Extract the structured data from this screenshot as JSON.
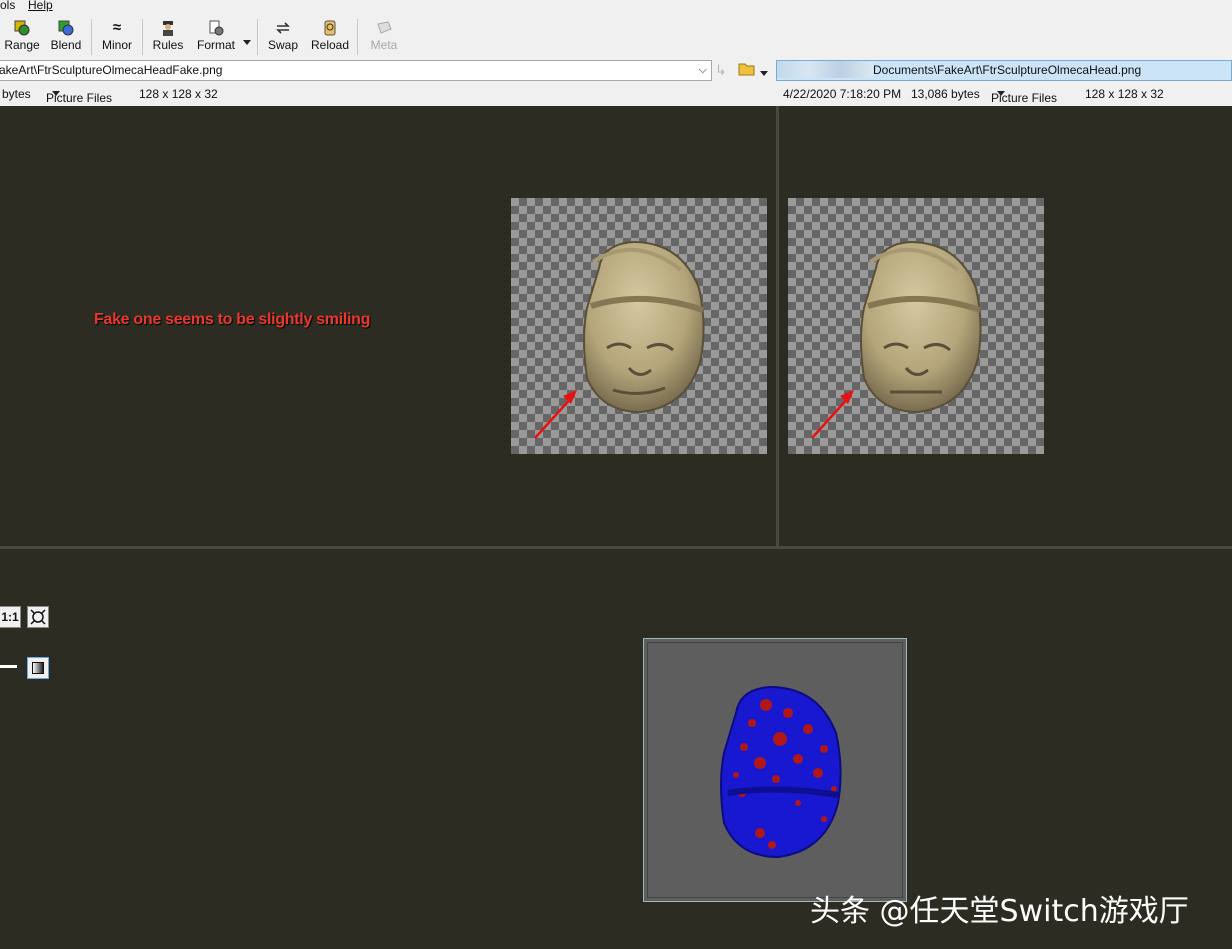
{
  "menu": {
    "tools_label": "ols",
    "help_label": "Help"
  },
  "toolbar": {
    "range": "Range",
    "blend": "Blend",
    "minor": "Minor",
    "rules": "Rules",
    "format": "Format",
    "swap": "Swap",
    "reload": "Reload",
    "meta": "Meta"
  },
  "left": {
    "path": "akeArt\\FtrSculptureOlmecaHeadFake.png",
    "size": "bytes",
    "filetype": "Picture Files",
    "dims": "128 x 128 x 32"
  },
  "right": {
    "path": "Documents\\FakeArt\\FtrSculptureOlmecaHead.png",
    "date": "4/22/2020 7:18:20 PM",
    "size": "13,086 bytes",
    "filetype": "Picture Files",
    "dims": "128 x 128 x 32"
  },
  "annotation": "Fake one seems to be slightly smiling",
  "zoom_button": "1:1",
  "watermark": "头条 @任天堂Switch游戏厅",
  "colors": {
    "accent_red": "#e8392f",
    "background": "#2d2c22",
    "diff_blue": "#1a1ad8",
    "diff_red": "#b01818"
  }
}
